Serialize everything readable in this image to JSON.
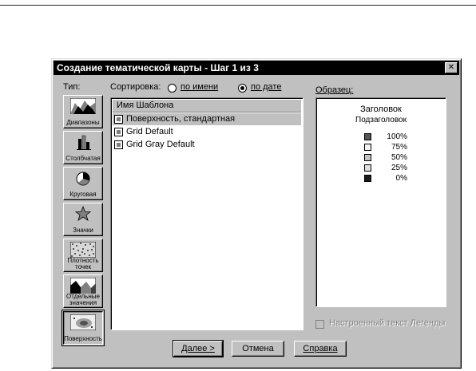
{
  "window": {
    "title": "Создание тематической карты - Шаг 1 из 3",
    "close_glyph": "✕"
  },
  "type_section": {
    "label": "Тип:",
    "buttons": [
      {
        "label": "Диапазоны",
        "icon": "ranges-map-icon"
      },
      {
        "label": "Столбчатая",
        "icon": "bar-chart-icon"
      },
      {
        "label": "Круговая",
        "icon": "pie-chart-icon"
      },
      {
        "label": "Значки",
        "icon": "star-symbol-icon"
      },
      {
        "label": "Плотность точек",
        "icon": "dot-density-icon"
      },
      {
        "label": "Отдельные значения",
        "icon": "individual-values-map-icon"
      },
      {
        "label": "Поверхность",
        "icon": "surface-map-icon",
        "selected": true
      }
    ]
  },
  "sort": {
    "label": "Сортировка:",
    "by_name": "по имени",
    "by_date": "по дате",
    "selected": "by_date"
  },
  "templates": {
    "header": "Имя Шаблона",
    "items": [
      {
        "label": "Поверхность, стандартная",
        "selected": true
      },
      {
        "label": "Grid Default"
      },
      {
        "label": "Grid Gray Default"
      }
    ]
  },
  "preview": {
    "label": "Образец:",
    "title": "Заголовок",
    "subtitle": "Подзаголовок",
    "legend": [
      {
        "label": "100%",
        "color": "#555555"
      },
      {
        "label": "75%",
        "color": "#f4f4f4"
      },
      {
        "label": "50%",
        "color": "#c4c4c4"
      },
      {
        "label": "25%",
        "color": "#e0e0e0"
      },
      {
        "label": "0%",
        "color": "#1a1a1a"
      }
    ]
  },
  "custom_legend": {
    "label": "Настроенный текст Легенды",
    "checked": false,
    "enabled": false
  },
  "buttons": {
    "next": "Далее >",
    "cancel": "Отмена",
    "help": "Справка"
  }
}
